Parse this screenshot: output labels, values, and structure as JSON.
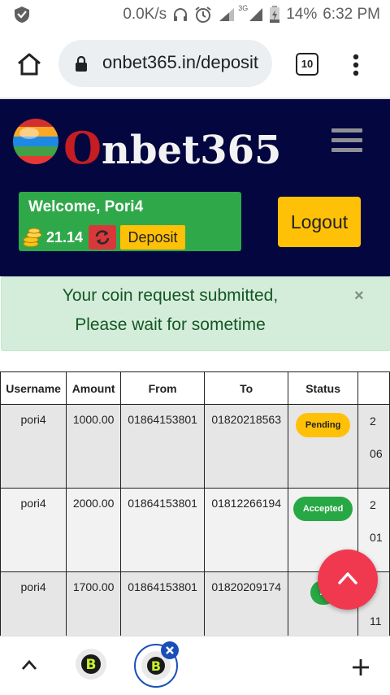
{
  "status_bar": {
    "net_speed": "0.0K/s",
    "battery": "14%",
    "time": "6:32 PM",
    "signal_label": "3G"
  },
  "browser": {
    "url": "onbet365.in/deposit",
    "tab_count": "10"
  },
  "site": {
    "logo_first": "O",
    "logo_rest": "nbet365",
    "welcome": "Welcome, Pori4",
    "balance": "21.14",
    "deposit_label": "Deposit",
    "logout_label": "Logout"
  },
  "alert": {
    "message_line1": "Your coin request submitted,",
    "message_line2": "Please wait for sometime",
    "close": "×"
  },
  "table": {
    "headers": [
      "Username",
      "Amount",
      "From",
      "To",
      "Status"
    ],
    "rows": [
      {
        "username": "pori4",
        "amount": "1000.00",
        "from": "01864153801",
        "to": "01820218563",
        "status": "Pending",
        "date1": "2",
        "date2": "06"
      },
      {
        "username": "pori4",
        "amount": "2000.00",
        "from": "01864153801",
        "to": "01812266194",
        "status": "Accepted",
        "date1": "2",
        "date2": "01"
      },
      {
        "username": "pori4",
        "amount": "1700.00",
        "from": "01864153801",
        "to": "01820209174",
        "status": "A",
        "date1": "2",
        "date2": "11"
      }
    ]
  },
  "colors": {
    "header_bg": "#04063f",
    "accent_yellow": "#ffc107",
    "success_green": "#28a745",
    "danger_red": "#f0394f"
  }
}
